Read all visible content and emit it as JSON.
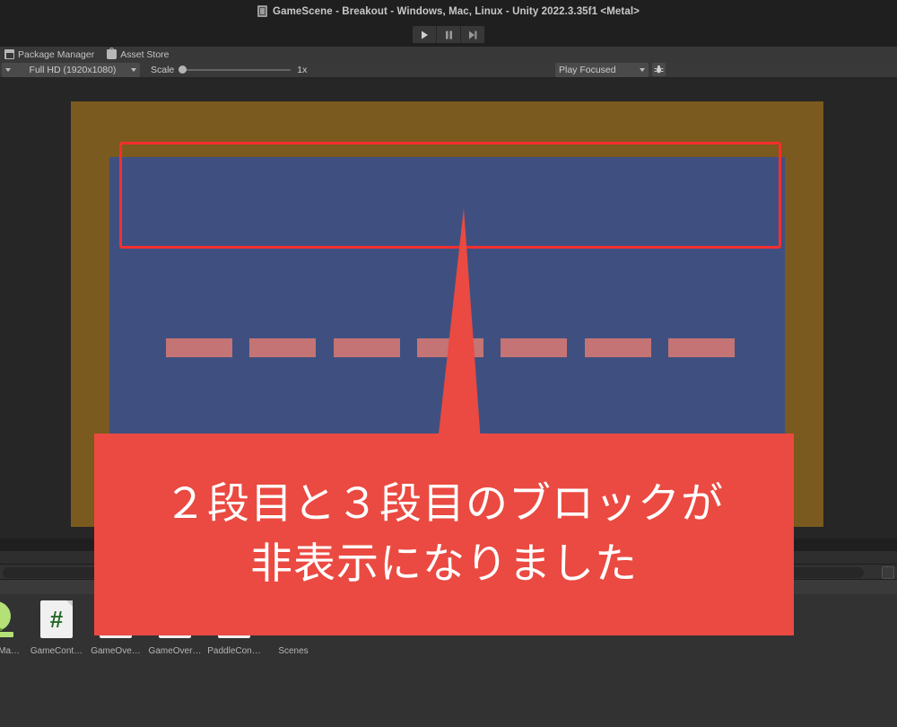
{
  "window": {
    "title": "GameScene - Breakout - Windows, Mac, Linux - Unity 2022.3.35f1 <Metal>",
    "scene_icon": "scene-icon"
  },
  "playbar": {
    "play_label": "▶",
    "pause_label": "⏸",
    "step_label": "⏭",
    "play_name": "play-button",
    "pause_name": "pause-button",
    "step_name": "step-button"
  },
  "tabs": [
    {
      "label": "Package Manager",
      "icon": "package-manager-icon",
      "active": false
    },
    {
      "label": "Asset Store",
      "icon": "asset-store-icon",
      "active": false
    }
  ],
  "game_toolbar": {
    "aspect_ratio": "Full HD (1920x1080)",
    "scale_label": "Scale",
    "scale_value": "1x",
    "scale_position_percent": 0,
    "play_mode": "Play Focused",
    "bug_icon": "bug-icon"
  },
  "game_view": {
    "background_color": "#7a5a1e",
    "playfield_color": "#3f5080",
    "block_color": "#c47474",
    "block_row_count": 1,
    "blocks_per_row": 7,
    "blocks": [
      {
        "index": 1
      },
      {
        "index": 2
      },
      {
        "index": 3
      },
      {
        "index": 4
      },
      {
        "index": 5
      },
      {
        "index": 6
      },
      {
        "index": 7
      }
    ]
  },
  "annotation": {
    "accent_color": "#ea4a41",
    "rect_color": "#f52e2e",
    "text_color": "#ffffff",
    "lines": [
      "２段目と３段目のブロックが",
      "非表示になりました"
    ]
  },
  "project_browser": {
    "search_placeholder": "",
    "assets": [
      {
        "label": "…nceMa…",
        "icon": "prefab-icon",
        "type": "prefab"
      },
      {
        "label": "GameCont…",
        "icon": "csharp-script-icon",
        "type": "script"
      },
      {
        "label": "GameOve…",
        "icon": "csharp-script-icon",
        "type": "script"
      },
      {
        "label": "GameOver…",
        "icon": "csharp-script-icon",
        "type": "script"
      },
      {
        "label": "PaddleCon…",
        "icon": "csharp-script-icon",
        "type": "script"
      },
      {
        "label": "Scenes",
        "icon": "folder-icon",
        "type": "folder"
      }
    ]
  }
}
